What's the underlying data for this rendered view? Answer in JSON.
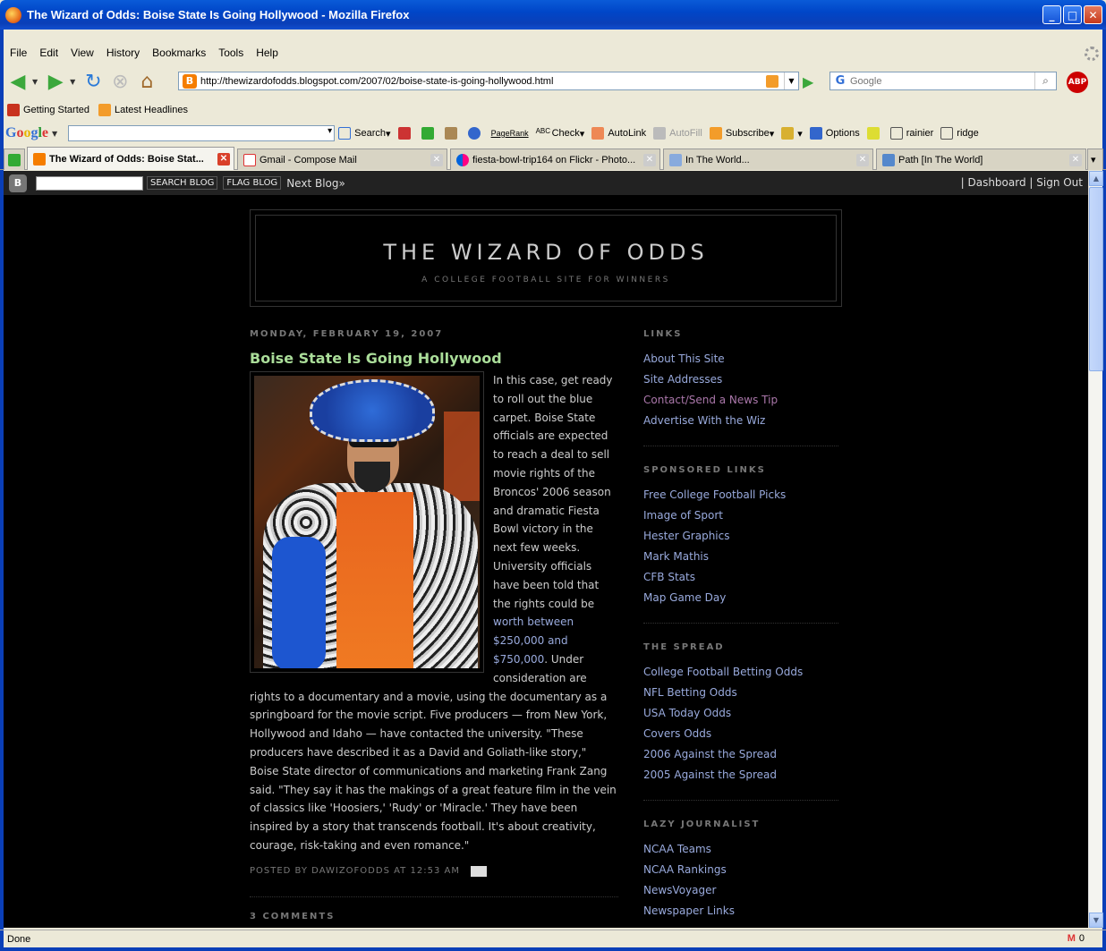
{
  "window": {
    "title": "The Wizard of Odds: Boise State Is Going Hollywood - Mozilla Firefox",
    "minimize": "_",
    "maximize": "□",
    "close": "✕"
  },
  "menu": [
    "File",
    "Edit",
    "View",
    "History",
    "Bookmarks",
    "Tools",
    "Help"
  ],
  "nav": {
    "url": "http://thewizardofodds.blogspot.com/2007/02/boise-state-is-going-hollywood.html",
    "search_placeholder": "Google",
    "abp": "ABP"
  },
  "bookmarks": [
    "Getting Started",
    "Latest Headlines"
  ],
  "google_toolbar": {
    "logo": "Google",
    "items": [
      "Search",
      "Check",
      "AutoLink",
      "AutoFill",
      "Subscribe",
      "Options",
      "rainier",
      "ridge"
    ],
    "pagerank": "PageRank"
  },
  "tabs": [
    {
      "label": "The Wizard of Odds: Boise Stat...",
      "active": true
    },
    {
      "label": "Gmail - Compose Mail",
      "active": false
    },
    {
      "label": "fiesta-bowl-trip164 on Flickr - Photo...",
      "active": false
    },
    {
      "label": "In The World...",
      "active": false
    },
    {
      "label": "Path [In The World]",
      "active": false
    }
  ],
  "blogger_bar": {
    "search_button": "SEARCH BLOG",
    "flag_button": "FLAG BLOG",
    "next_blog": "Next Blog»",
    "dashboard": "Dashboard",
    "signout": "Sign Out"
  },
  "blog": {
    "title": "THE WIZARD OF ODDS",
    "description": "A COLLEGE FOOTBALL SITE FOR WINNERS"
  },
  "post": {
    "date": "MONDAY, FEBRUARY 19, 2007",
    "title": "Boise State Is Going Hollywood",
    "body_before_link": "In this case, get ready to roll out the blue carpet. Boise State officials are expected to reach a deal to sell movie rights of the Broncos' 2006 season and dramatic Fiesta Bowl victory in the next few weeks. University officials have been told that the rights could be ",
    "body_link": "worth between $250,000 and $750,000",
    "body_after_link": ". Under consideration are rights to a documentary and a movie, using the documentary as a springboard for the movie script. Five producers — from New York, Hollywood and Idaho — have contacted the university. \"These producers have described it as a David and Goliath-like story,\" Boise State director of communications and marketing Frank Zang said. \"They say it has the makings of a great feature film in the vein of classics like 'Hoosiers,' 'Rudy' or 'Miracle.' They have been inspired by a story that transcends football. It's about creativity, courage, risk-taking and even romance.\"",
    "footer_posted_by": "POSTED BY",
    "author": "DAWIZOFODDS",
    "footer_at": "AT",
    "time": "12:53 AM",
    "comments": "3 COMMENTS"
  },
  "sidebar": {
    "links": {
      "heading": "LINKS",
      "items": [
        "About This Site",
        "Site Addresses",
        "Contact/Send a News Tip",
        "Advertise With the Wiz"
      ]
    },
    "sponsored": {
      "heading": "SPONSORED LINKS",
      "items": [
        "Free College Football Picks",
        "Image of Sport",
        "Hester Graphics",
        "Mark Mathis",
        "CFB Stats",
        "Map Game Day"
      ]
    },
    "spread": {
      "heading": "THE SPREAD",
      "items": [
        "College Football Betting Odds",
        "NFL Betting Odds",
        "USA Today Odds",
        "Covers Odds",
        "2006 Against the Spread",
        "2005 Against the Spread"
      ]
    },
    "lazy": {
      "heading": "LAZY JOURNALIST",
      "items": [
        "NCAA Teams",
        "NCAA Rankings",
        "NewsVoyager",
        "Newspaper Links"
      ]
    }
  },
  "status": {
    "text": "Done",
    "gmail_count": "0",
    "gmail_icon": "M"
  },
  "colors": {
    "post_title": "#aadd99",
    "link": "#99aadd",
    "visited_link": "#aa77aa",
    "background": "#000000"
  }
}
